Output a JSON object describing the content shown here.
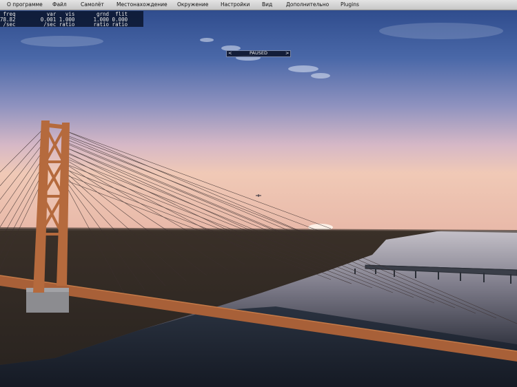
{
  "menu": {
    "items": [
      {
        "label": "О программе",
        "name": "menu-about"
      },
      {
        "label": "Файл",
        "name": "menu-file"
      },
      {
        "label": "Самолёт",
        "name": "menu-aircraft"
      },
      {
        "label": "Местонахождение",
        "name": "menu-location"
      },
      {
        "label": "Окружение",
        "name": "menu-environment"
      },
      {
        "label": "Настройки",
        "name": "menu-settings"
      },
      {
        "label": "Вид",
        "name": "menu-view"
      },
      {
        "label": "Дополнительно",
        "name": "menu-extra"
      },
      {
        "label": "Plugins",
        "name": "menu-plugins"
      }
    ]
  },
  "stats": {
    "row1": " freq          var   vis       grnd  flit",
    "row2": "78.82        0.001 1.000      1.000 0.000",
    "row3": " /sec         /sec ratio      ratio ratio"
  },
  "paused": {
    "left": "<",
    "label": "PAUSED",
    "right": ">"
  },
  "colors": {
    "sky_top": "#304e90",
    "sky_horizon": "#ecc3b4",
    "bridge": "#b56a3d",
    "water": "#1c2430"
  }
}
